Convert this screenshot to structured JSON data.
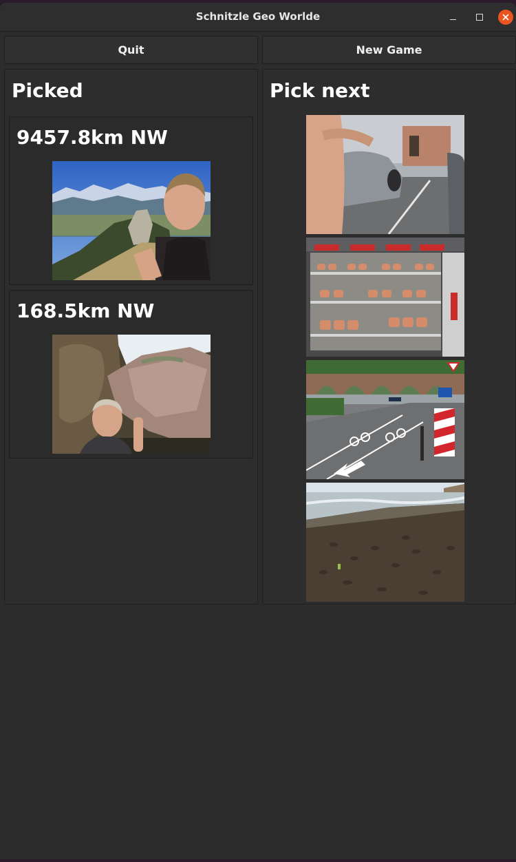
{
  "window": {
    "title": "Schnitzle Geo Worlde"
  },
  "toolbar": {
    "quit_label": "Quit",
    "new_game_label": "New Game"
  },
  "picked": {
    "heading": "Picked",
    "guesses": [
      {
        "distance": "9457.8km NW",
        "photo": "alpine-selfie-photo"
      },
      {
        "distance": "168.5km NW",
        "photo": "boulder-selfie-photo"
      }
    ]
  },
  "pick_next": {
    "heading": "Pick next",
    "options": [
      {
        "photo": "car-parking-lot-photo"
      },
      {
        "photo": "bakery-display-case-photo"
      },
      {
        "photo": "bridge-bike-lane-photo"
      },
      {
        "photo": "dark-sand-beach-photo"
      }
    ]
  },
  "colors": {
    "accent_close": "#e95420",
    "background": "#2c2c2c"
  }
}
